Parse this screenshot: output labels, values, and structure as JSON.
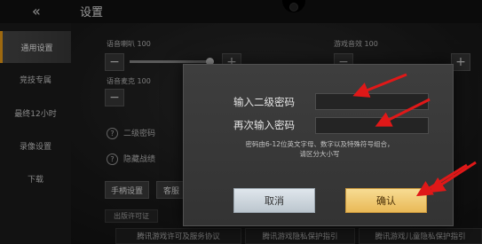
{
  "topbar": {
    "back_glyph": "«",
    "title": "设置"
  },
  "sidebar": {
    "items": [
      {
        "label": "通用设置",
        "active": true
      },
      {
        "label": "竞技专属",
        "active": false
      },
      {
        "label": "最终12小时",
        "active": false
      },
      {
        "label": "录像设置",
        "active": false
      },
      {
        "label": "下载",
        "active": false
      }
    ]
  },
  "settings": {
    "speaker_label": "语音喇叭 100",
    "game_sound_label": "游戏音效 100",
    "mic_label": "语音麦克 100",
    "minus": "−",
    "plus": "+",
    "help_rows": [
      {
        "q": "?",
        "label": "二级密码"
      },
      {
        "q": "?",
        "label": "隐藏战绩"
      }
    ],
    "tabs": {
      "controller": "手柄设置",
      "service": "客服"
    },
    "license_link": "出版许可证",
    "footer_links": [
      "腾讯游戏许可及服务协议",
      "腾讯游戏隐私保护指引",
      "腾讯游戏儿童隐私保护指引"
    ]
  },
  "dialog": {
    "label_password": "输入二级密码",
    "label_confirm": "再次输入密码",
    "password_value": "",
    "confirm_value": "",
    "hint_line1": "密码由6-12位英文字母、数字以及特殊符号组合，",
    "hint_line2": "请区分大小写",
    "cancel_label": "取消",
    "confirm_label": "确认"
  },
  "colors": {
    "accent": "#f3a21a",
    "arrow": "#e01818",
    "confirm_button": "#f0c86a",
    "cancel_button": "#cfd7de"
  }
}
